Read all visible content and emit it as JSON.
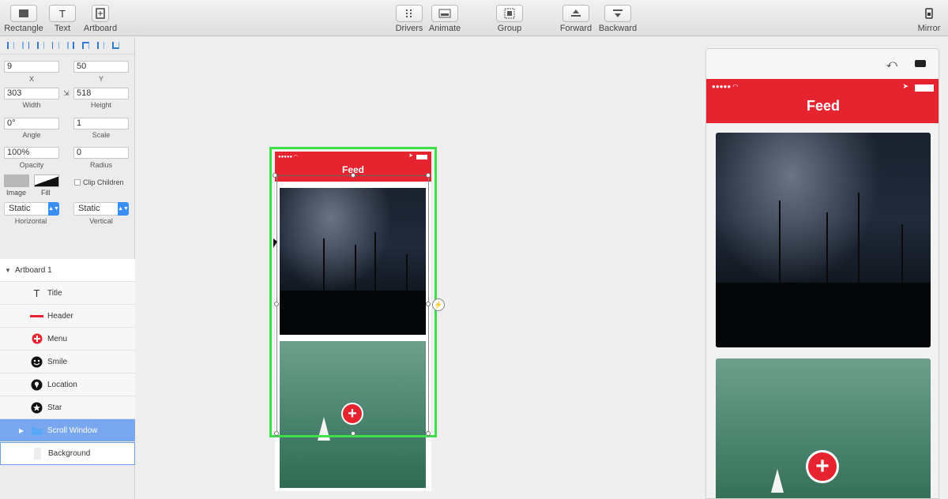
{
  "toolbar": {
    "left": [
      {
        "label": "Rectangle",
        "icon": "rectangle-icon"
      },
      {
        "label": "Text",
        "icon": "text-icon"
      },
      {
        "label": "Artboard",
        "icon": "artboard-icon"
      }
    ],
    "center": [
      {
        "label": "Drivers",
        "icon": "drivers-icon"
      },
      {
        "label": "Animate",
        "icon": "animate-icon"
      },
      {
        "label": "Group",
        "icon": "group-icon"
      },
      {
        "label": "Forward",
        "icon": "forward-icon"
      },
      {
        "label": "Backward",
        "icon": "backward-icon"
      }
    ],
    "right": {
      "label": "Mirror",
      "icon": "mirror-icon"
    }
  },
  "inspector": {
    "x": {
      "value": "9",
      "label": "X"
    },
    "y": {
      "value": "50",
      "label": "Y"
    },
    "width": {
      "value": "303",
      "label": "Width"
    },
    "height": {
      "value": "518",
      "label": "Height"
    },
    "angle": {
      "value": "0°",
      "label": "Angle"
    },
    "scale": {
      "value": "1",
      "label": "Scale"
    },
    "opacity": {
      "value": "100%",
      "label": "Opacity"
    },
    "radius": {
      "value": "0",
      "label": "Radius"
    },
    "image_label": "Image",
    "fill_label": "Fill",
    "clip_children": "Clip Children",
    "horizontal": {
      "value": "Static",
      "label": "Horizontal"
    },
    "vertical": {
      "value": "Static",
      "label": "Vertical"
    }
  },
  "layers": {
    "root": "Artboard 1",
    "items": [
      {
        "label": "Title",
        "icon": "text-icon"
      },
      {
        "label": "Header",
        "icon": "red-line-icon"
      },
      {
        "label": "Menu",
        "icon": "plus-circle-icon"
      },
      {
        "label": "Smile",
        "icon": "smile-icon"
      },
      {
        "label": "Location",
        "icon": "location-pin-icon"
      },
      {
        "label": "Star",
        "icon": "star-icon"
      },
      {
        "label": "Scroll Window",
        "icon": "folder-icon"
      },
      {
        "label": "Background",
        "icon": "background-icon"
      }
    ]
  },
  "artboard": {
    "feed_title": "Feed",
    "fab_symbol": "+"
  },
  "preview": {
    "feed_title": "Feed",
    "fab_symbol": "+",
    "undo_symbol": "⤺"
  },
  "colors": {
    "header_red": "#e6242f",
    "selection_green": "#3ee04a",
    "accent_blue": "#3b8ef2"
  }
}
